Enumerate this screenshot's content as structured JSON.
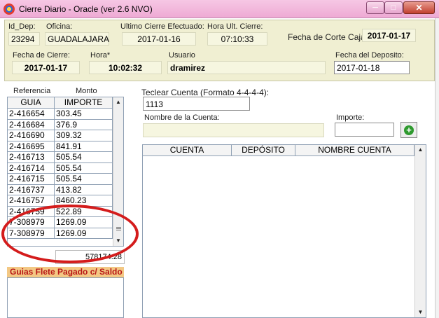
{
  "window": {
    "title": "Cierre Diario  - Oracle (ver 2.6 NVO)",
    "minimize_glyph": "─",
    "maximize_glyph": "□",
    "close_glyph": "✕"
  },
  "header": {
    "id_dep_label": "Id_Dep:",
    "id_dep_value": "23294",
    "oficina_label": "Oficina:",
    "oficina_value": "GUADALAJARA",
    "ultimo_cierre_label": "Ultimo Cierre Efectuado:",
    "ultimo_cierre_value": "2017-01-16",
    "hora_ult_label": "Hora Ult. Cierre:",
    "hora_ult_value": "07:10:33",
    "fecha_corte_label": "Fecha de Corte Caja:",
    "fecha_corte_value": "2017-01-17",
    "fecha_cierre_label": "Fecha de Cierre:",
    "fecha_cierre_value": "2017-01-17",
    "hora_label": "Hora*",
    "hora_value": "10:02:32",
    "usuario_label": "Usuario",
    "usuario_value": "dramirez",
    "fecha_deposito_label": "Fecha del Deposito:",
    "fecha_deposito_value": "2017-01-18"
  },
  "left_grid": {
    "referencia_label": "Referencia",
    "monto_label": "Monto",
    "columns": [
      "GUIA",
      "IMPORTE"
    ],
    "rows": [
      [
        "2-416654",
        "303.45"
      ],
      [
        "2-416684",
        "376.9"
      ],
      [
        "2-416690",
        "309.32"
      ],
      [
        "2-416695",
        "841.91"
      ],
      [
        "2-416713",
        "505.54"
      ],
      [
        "2-416714",
        "505.54"
      ],
      [
        "2-416715",
        "505.54"
      ],
      [
        "2-416737",
        "413.82"
      ],
      [
        "2-416757",
        "8460.23"
      ],
      [
        "2-416759",
        "522.89"
      ],
      [
        "7-308979",
        "1269.09"
      ],
      [
        "7-308979",
        "1269.09"
      ]
    ],
    "total": "578174.28"
  },
  "guias_panel": {
    "title": "Guias Flete Pagado c/ Saldo"
  },
  "right_section": {
    "cuenta_label": "Teclear Cuenta (Formato 4-4-4-4):",
    "cuenta_value": "1113",
    "nombre_label": "Nombre de la Cuenta:",
    "importe_label": "Importe:",
    "add_glyph": "+",
    "columns": [
      "CUENTA",
      "DEPÓSITO",
      "NOMBRE CUENTA"
    ]
  },
  "colors": {
    "titlebar": "#eeaad4",
    "panel_beige": "#f0efd2",
    "guias_title_bg": "#f3c884",
    "guias_title_text": "#b81717",
    "annotation_red": "#d41c1c"
  }
}
